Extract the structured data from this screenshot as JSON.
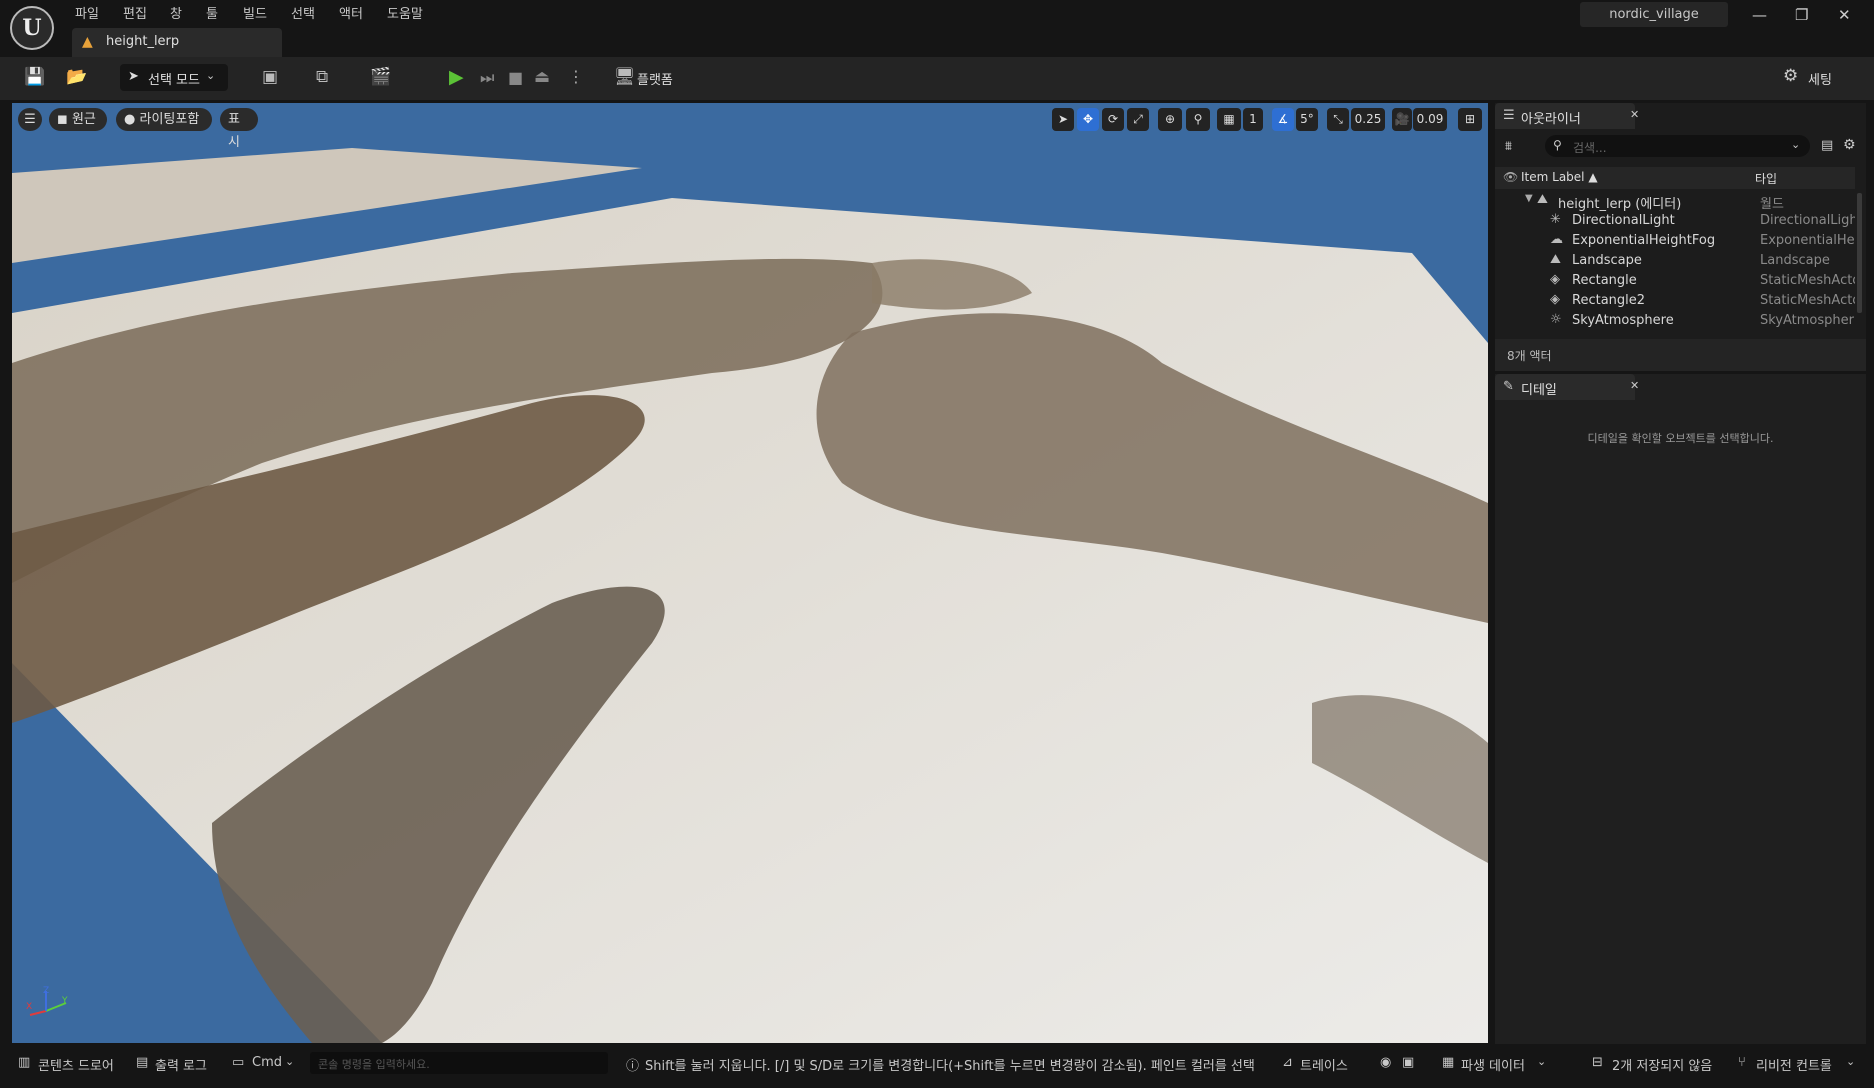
{
  "menu": [
    "파일",
    "편집",
    "창",
    "툴",
    "빌드",
    "선택",
    "액터",
    "도움말"
  ],
  "project_name": "nordic_village",
  "tab": {
    "label": "height_lerp"
  },
  "window_controls": [
    "—",
    "❐",
    "✕"
  ],
  "toolbar": {
    "select_mode": "선택 모드",
    "platform": "플랫폼",
    "settings": "세팅"
  },
  "viewport": {
    "perspective": "원근",
    "lighting": "라이팅포함",
    "show": "표시",
    "grid_size": "1",
    "rotation_snap": "5°",
    "scale_snap": "0.25",
    "camera_speed": "0.09",
    "axis_labels": {
      "x": "X",
      "y": "Y",
      "z": "Z"
    }
  },
  "outliner": {
    "title": "아웃라이너",
    "search_placeholder": "검색...",
    "col_label": "Item Label ▲",
    "col_type": "타입",
    "root": {
      "name": "height_lerp (에디터)",
      "type": "월드"
    },
    "items": [
      {
        "name": "DirectionalLight",
        "type": "DirectionalLigh",
        "icon": "✳"
      },
      {
        "name": "ExponentialHeightFog",
        "type": "ExponentialHei",
        "icon": "☁"
      },
      {
        "name": "Landscape",
        "type": "Landscape",
        "icon": "⛰"
      },
      {
        "name": "Rectangle",
        "type": "StaticMeshActo",
        "icon": "◈"
      },
      {
        "name": "Rectangle2",
        "type": "StaticMeshActo",
        "icon": "◈"
      },
      {
        "name": "SkyAtmosphere",
        "type": "SkyAtmospher",
        "icon": "☼"
      }
    ],
    "actor_count": "8개 액터"
  },
  "details": {
    "title": "디테일",
    "empty_message": "디테일을 확인할 오브젝트를 선택합니다."
  },
  "statusbar": {
    "content_drawer": "콘텐츠 드로어",
    "output_log": "출력 로그",
    "cmd": "Cmd",
    "console_placeholder": "콘솔 명령을 입력하세요.",
    "hint": "Shift를 눌러 지웁니다. [/] 및 S/D로 크기를 변경합니다(+Shift를 누르면 변경량이 감소됨). 페인트 컬러를 선택하려",
    "trace": "트레이스",
    "derived_data": "파생 데이터",
    "unsaved": "2개 저장되지 않음",
    "revision": "리비전 컨트롤"
  }
}
